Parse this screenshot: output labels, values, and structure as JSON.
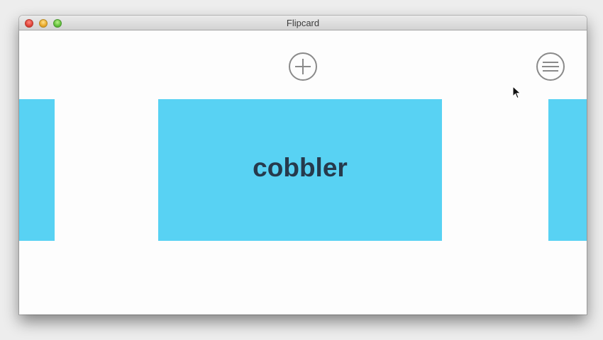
{
  "window": {
    "title": "Flipcard"
  },
  "toolbar": {
    "add_icon": "plus-circle-icon",
    "menu_icon": "hamburger-circle-icon"
  },
  "cards": {
    "current_word": "cobbler",
    "color": "#58d2f3",
    "text_color": "#263a4c"
  }
}
